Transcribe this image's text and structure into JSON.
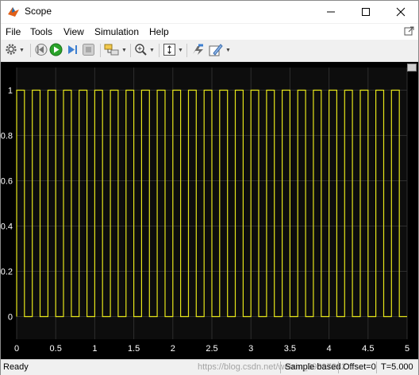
{
  "window": {
    "title": "Scope"
  },
  "menu": {
    "file": "File",
    "tools": "Tools",
    "view": "View",
    "simulation": "Simulation",
    "help": "Help"
  },
  "toolbar_icons": [
    "gear-icon",
    "chevron-down-icon",
    "step-back-icon",
    "run-icon",
    "step-forward-icon",
    "stop-icon",
    "highlight-block-icon",
    "zoom-icon",
    "autoscale-icon",
    "signal-select-icon",
    "style-icon"
  ],
  "colors": {
    "signal": "#e6e619",
    "plot_bg": "#000000",
    "axes_bg": "#0d0d0d",
    "grid": "#2e2e2e",
    "tick_text": "#ffffff"
  },
  "chart_data": {
    "type": "line",
    "title": "",
    "xlabel": "",
    "ylabel": "",
    "xlim": [
      0,
      5
    ],
    "ylim": [
      -0.1,
      1.1
    ],
    "xticks": [
      "0",
      "0.5",
      "1",
      "1.5",
      "2",
      "2.5",
      "3",
      "3.5",
      "4",
      "4.5",
      "5"
    ],
    "yticks": [
      "0",
      "0.2",
      "0.4",
      "0.6",
      "0.8",
      "1"
    ],
    "grid": true,
    "series": [
      {
        "waveform": "square",
        "period": 0.2,
        "duty": 0.5,
        "low": 0,
        "high": 1,
        "x_start": 0,
        "x_end": 5
      }
    ]
  },
  "status": {
    "ready": "Ready",
    "watermark": "https://blog.csdn.net/weixin_39897282",
    "mode": "Sample based",
    "offset": "Offset=0",
    "time": "T=5.000"
  }
}
